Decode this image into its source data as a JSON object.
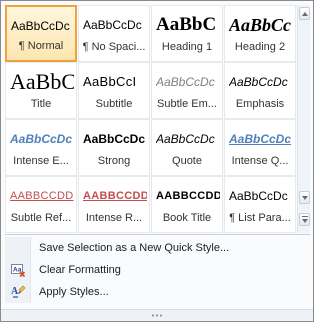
{
  "styles": [
    {
      "preview": "AaBbCcDc",
      "label": "¶ Normal",
      "cls": "p-normal",
      "selected": true
    },
    {
      "preview": "AaBbCcDc",
      "label": "¶ No Spaci...",
      "cls": "p-nospace"
    },
    {
      "preview": "AaBbC",
      "label": "Heading 1",
      "cls": "p-h1"
    },
    {
      "preview": "AaBbCc",
      "label": "Heading 2",
      "cls": "p-h2"
    },
    {
      "preview": "AaBbC",
      "label": "Title",
      "cls": "p-title"
    },
    {
      "preview": "AaBbCcI",
      "label": "Subtitle",
      "cls": "p-subtitle"
    },
    {
      "preview": "AaBbCcDc",
      "label": "Subtle Em...",
      "cls": "p-subtle"
    },
    {
      "preview": "AaBbCcDc",
      "label": "Emphasis",
      "cls": "p-emph"
    },
    {
      "preview": "AaBbCcDc",
      "label": "Intense E...",
      "cls": "p-intense"
    },
    {
      "preview": "AaBbCcDc",
      "label": "Strong",
      "cls": "p-strong"
    },
    {
      "preview": "AaBbCcDc",
      "label": "Quote",
      "cls": "p-quote"
    },
    {
      "preview": "AaBbCcDc",
      "label": "Intense Q...",
      "cls": "p-intq"
    },
    {
      "preview": "AABBCCDD",
      "label": "Subtle Ref...",
      "cls": "p-subref"
    },
    {
      "preview": "AABBCCDD",
      "label": "Intense R...",
      "cls": "p-intref"
    },
    {
      "preview": "AABBCCDD",
      "label": "Book Title",
      "cls": "p-book"
    },
    {
      "preview": "AaBbCcDc",
      "label": "¶ List Para...",
      "cls": "p-list"
    }
  ],
  "menu": {
    "save_selection": "Save Selection as a New Quick Style...",
    "clear_formatting": "Clear Formatting",
    "apply_styles": "Apply Styles..."
  },
  "icons": {
    "save_selection": "save-style-icon",
    "clear_formatting": "clear-formatting-icon",
    "apply_styles": "apply-styles-icon"
  },
  "colors": {
    "selected_border": "#f2a23a",
    "accent_blue": "#4f81bd",
    "accent_red": "#c0504d"
  }
}
